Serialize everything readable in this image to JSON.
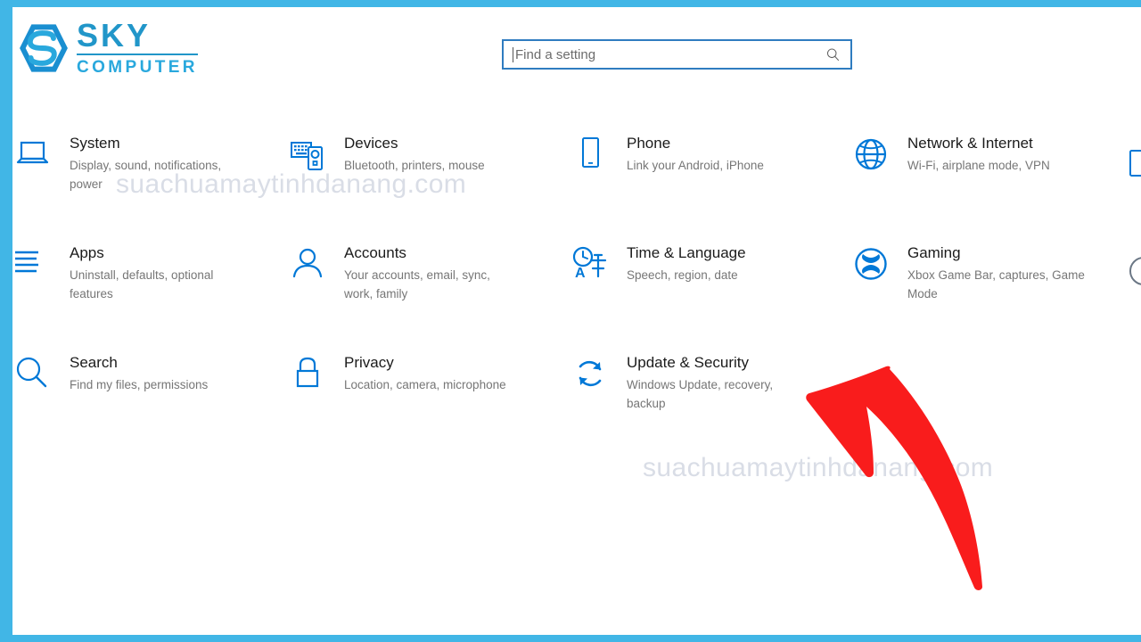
{
  "window": {
    "frame_color": "#41b6e6",
    "background": "#ffffff"
  },
  "branding": {
    "logo_icon": "sky-hexagon-s-logo",
    "name_primary": "SKY",
    "name_secondary": "COMPUTER",
    "primary_color": "#2196c9",
    "secondary_color": "#29a8dd"
  },
  "search": {
    "placeholder": "Find a setting",
    "value": "",
    "icon": "search-icon",
    "border_color": "#2f7cc0"
  },
  "settings": {
    "rows": [
      [
        {
          "id": "system",
          "icon": "laptop-icon",
          "title": "System",
          "subtitle": "Display, sound, notifications, power"
        },
        {
          "id": "devices",
          "icon": "keyboard-device-icon",
          "title": "Devices",
          "subtitle": "Bluetooth, printers, mouse"
        },
        {
          "id": "phone",
          "icon": "phone-icon",
          "title": "Phone",
          "subtitle": "Link your Android, iPhone"
        },
        {
          "id": "network-internet",
          "icon": "globe-icon",
          "title": "Network & Internet",
          "subtitle": "Wi-Fi, airplane mode, VPN"
        }
      ],
      [
        {
          "id": "apps",
          "icon": "list-lines-icon",
          "title": "Apps",
          "subtitle": "Uninstall, defaults, optional features"
        },
        {
          "id": "accounts",
          "icon": "person-icon",
          "title": "Accounts",
          "subtitle": "Your accounts, email, sync, work, family"
        },
        {
          "id": "time-language",
          "icon": "clock-language-icon",
          "title": "Time & Language",
          "subtitle": "Speech, region, date"
        },
        {
          "id": "gaming",
          "icon": "xbox-icon",
          "title": "Gaming",
          "subtitle": "Xbox Game Bar, captures, Game Mode"
        }
      ],
      [
        {
          "id": "search",
          "icon": "magnifier-icon",
          "title": "Search",
          "subtitle": "Find my files, permissions"
        },
        {
          "id": "privacy",
          "icon": "lock-icon",
          "title": "Privacy",
          "subtitle": "Location, camera, microphone"
        },
        {
          "id": "update-security",
          "icon": "refresh-circular-arrows-icon",
          "title": "Update & Security",
          "subtitle": "Windows Update, recovery, backup"
        }
      ]
    ],
    "icon_color": "#0078d7",
    "title_color": "#1b1b1b",
    "subtitle_color": "#767676"
  },
  "annotation": {
    "arrow_icon": "curved-arrow-up-left",
    "arrow_color": "#f91c1c",
    "points_at": "update-security"
  },
  "watermark": {
    "text": "suachuamaytinhdanang.com",
    "color": "#d9dde6"
  }
}
